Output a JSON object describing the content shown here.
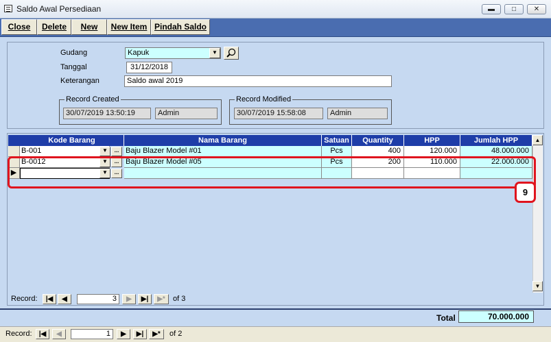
{
  "window": {
    "title": "Saldo Awal Persediaan",
    "min_label": "▬",
    "max_label": "□",
    "close_label": "✕"
  },
  "toolbar": {
    "close": "Close",
    "delete": "Delete",
    "new": "New",
    "new_item": "New Item",
    "pindah_saldo": "Pindah Saldo"
  },
  "header": {
    "gudang_label": "Gudang",
    "gudang_value": "Kapuk",
    "tanggal_label": "Tanggal",
    "tanggal_value": "31/12/2018",
    "keterangan_label": "Keterangan",
    "keterangan_value": "Saldo awal 2019",
    "record_created_title": "Record Created",
    "created_date": "30/07/2019 13:50:19",
    "created_user": "Admin",
    "record_modified_title": "Record Modified",
    "modified_date": "30/07/2019 15:58:08",
    "modified_user": "Admin"
  },
  "grid": {
    "columns": [
      "Kode Barang",
      "Nama Barang",
      "Satuan",
      "Quantity",
      "HPP",
      "Jumlah HPP"
    ],
    "rows": [
      {
        "kode": "B-001",
        "nama": "Baju Blazer Model #01",
        "satuan": "Pcs",
        "qty": "400",
        "hpp": "120.000",
        "jumlah": "48.000.000"
      },
      {
        "kode": "B-0012",
        "nama": "Baju Blazer Model #05",
        "satuan": "Pcs",
        "qty": "200",
        "hpp": "110.000",
        "jumlah": "22.000.000"
      }
    ],
    "ellipsis": "...",
    "nav": {
      "label": "Record:",
      "current": "3",
      "of_label": "of",
      "total": "3"
    }
  },
  "callout_number": "9",
  "footer": {
    "total_label": "Total",
    "total_value": "70.000.000",
    "nav": {
      "label": "Record:",
      "current": "1",
      "of_label": "of",
      "total": "2"
    }
  },
  "colors": {
    "background": "#c6d9f1",
    "toolbar": "#4a6db0",
    "grid_header": "#1e3da8",
    "highlight": "#e0141e",
    "field_cyan": "#ccffff"
  }
}
